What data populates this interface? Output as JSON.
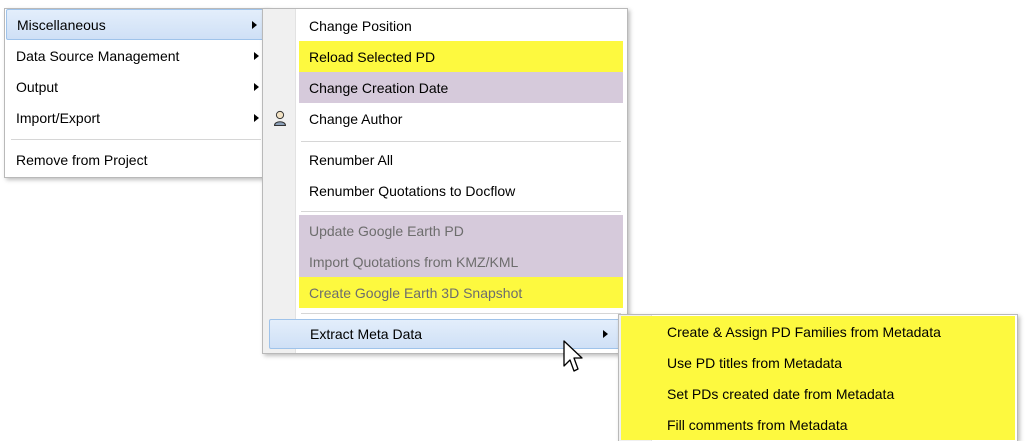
{
  "main_menu": {
    "items": [
      {
        "label": "Miscellaneous",
        "submenu": true
      },
      {
        "label": "Data Source Management",
        "submenu": true
      },
      {
        "label": "Output",
        "submenu": true
      },
      {
        "label": "Import/Export",
        "submenu": true
      },
      {
        "label": "Remove from Project",
        "submenu": false
      }
    ]
  },
  "misc_menu": {
    "items": [
      {
        "label": "Change Position"
      },
      {
        "label": "Reload Selected PD"
      },
      {
        "label": "Change Creation Date"
      },
      {
        "label": "Change Author",
        "icon": "person-icon"
      },
      {
        "label": "Renumber All"
      },
      {
        "label": "Renumber Quotations to Docflow"
      },
      {
        "label": "Update Google Earth PD"
      },
      {
        "label": "Import Quotations from KMZ/KML"
      },
      {
        "label": "Create Google Earth 3D Snapshot"
      },
      {
        "label": "Extract Meta Data",
        "submenu": true
      }
    ]
  },
  "meta_menu": {
    "items": [
      {
        "label": "Create & Assign PD Families from Metadata"
      },
      {
        "label": "Use PD titles from Metadata"
      },
      {
        "label": "Set PDs created date from Metadata"
      },
      {
        "label": "Fill comments from Metadata"
      }
    ]
  },
  "colors": {
    "highlight_yellow": "#fdf93f",
    "highlight_lavender": "#d6cadb",
    "hover_blue": "#cfe0f6"
  }
}
